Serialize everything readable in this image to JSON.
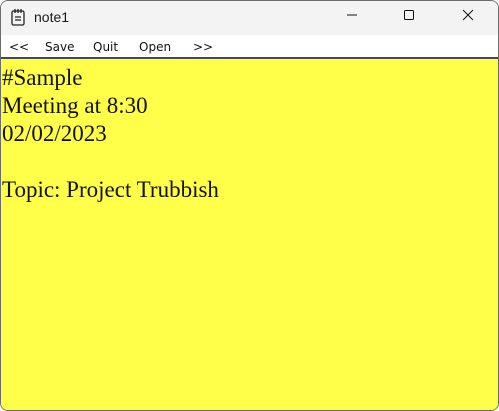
{
  "window": {
    "title": "note1",
    "icon": "notepad-icon"
  },
  "controls": {
    "minimize_icon": "minimize-icon",
    "maximize_icon": "maximize-icon",
    "close_icon": "close-icon"
  },
  "menu": {
    "items": [
      {
        "label": "<<"
      },
      {
        "label": "Save"
      },
      {
        "label": "Quit"
      },
      {
        "label": "Open"
      },
      {
        "label": ">>"
      }
    ]
  },
  "note": {
    "content": "#Sample\nMeeting at 8:30\n02/02/2023\n\nTopic: Project Trubbish"
  },
  "colors": {
    "background": "#ffff4a",
    "titlebar": "#f3f3f3"
  }
}
